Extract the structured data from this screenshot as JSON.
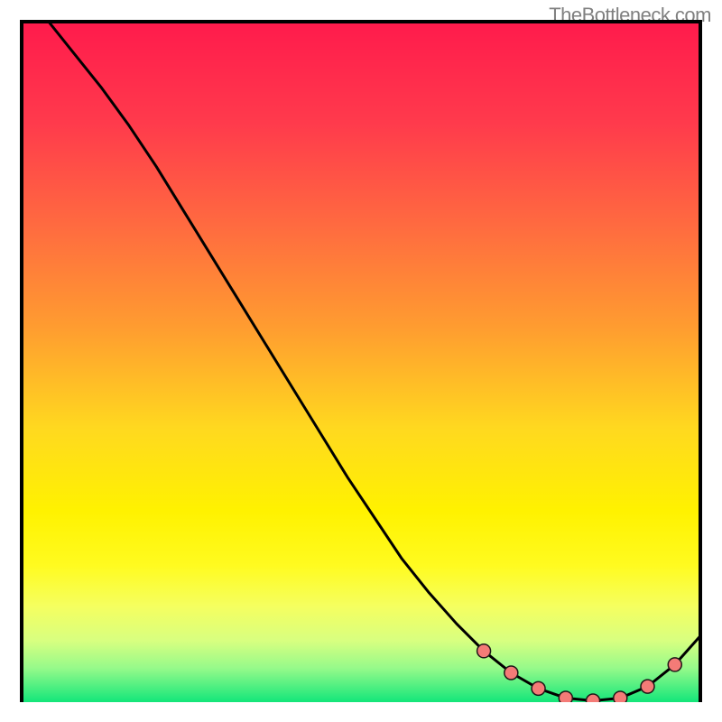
{
  "attribution": "TheBottleneck.com",
  "chart_data": {
    "type": "line",
    "title": "",
    "xlabel": "",
    "ylabel": "",
    "xlim": [
      0,
      100
    ],
    "ylim": [
      0,
      100
    ],
    "grid": false,
    "series": [
      {
        "name": "curve",
        "x": [
          4,
          8,
          12,
          16,
          20,
          24,
          28,
          32,
          36,
          40,
          44,
          48,
          52,
          56,
          60,
          64,
          68,
          72,
          76,
          80,
          84,
          88,
          92,
          96,
          100
        ],
        "y": [
          100,
          95,
          90,
          84.5,
          78.5,
          72,
          65.5,
          59,
          52.5,
          46,
          39.5,
          33,
          27,
          21,
          16,
          11.5,
          7.5,
          4.3,
          2,
          0.6,
          0.2,
          0.6,
          2.3,
          5.5,
          10
        ],
        "markers": [
          false,
          false,
          false,
          false,
          false,
          false,
          false,
          false,
          false,
          false,
          false,
          false,
          false,
          false,
          false,
          false,
          true,
          true,
          true,
          true,
          true,
          true,
          true,
          true,
          false
        ]
      }
    ],
    "background_gradient": {
      "type": "vertical",
      "stops": [
        {
          "offset": 0.0,
          "color": "#ff1a4c"
        },
        {
          "offset": 0.15,
          "color": "#ff3a4c"
        },
        {
          "offset": 0.3,
          "color": "#ff6a40"
        },
        {
          "offset": 0.45,
          "color": "#ff9c30"
        },
        {
          "offset": 0.6,
          "color": "#ffd91f"
        },
        {
          "offset": 0.72,
          "color": "#fff200"
        },
        {
          "offset": 0.8,
          "color": "#fffb20"
        },
        {
          "offset": 0.86,
          "color": "#f5ff60"
        },
        {
          "offset": 0.91,
          "color": "#d8ff80"
        },
        {
          "offset": 0.95,
          "color": "#96fa8a"
        },
        {
          "offset": 1.0,
          "color": "#13e67a"
        }
      ]
    },
    "marker_style": {
      "fill": "#f47b77",
      "stroke": "#201818",
      "r": 7.5
    },
    "line_style": {
      "stroke": "#000000",
      "width": 3
    },
    "frame_stroke": "#000000",
    "frame_width": 4
  }
}
